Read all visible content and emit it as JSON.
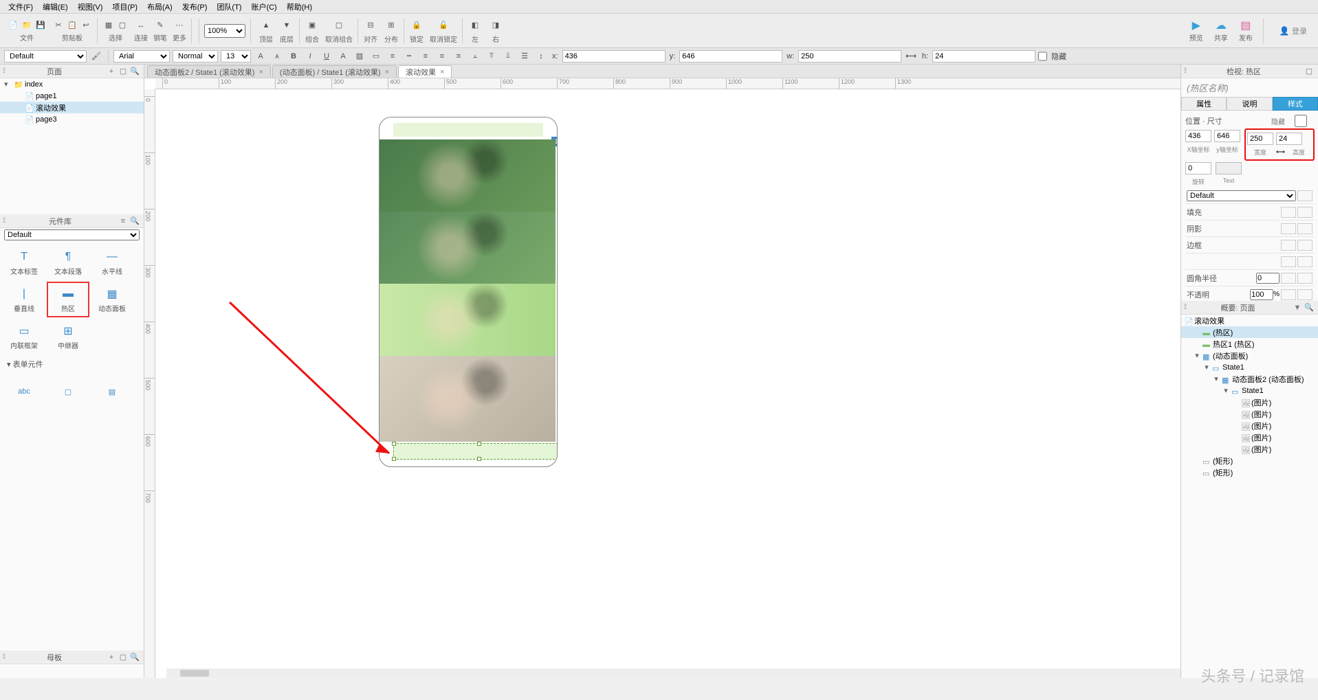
{
  "menu": [
    "文件(F)",
    "编辑(E)",
    "视图(V)",
    "项目(P)",
    "布局(A)",
    "发布(P)",
    "团队(T)",
    "账户(C)",
    "帮助(H)"
  ],
  "toolbar_groups": [
    {
      "label": "文件",
      "icons": [
        "📄",
        "📁",
        "💾"
      ]
    },
    {
      "label": "剪贴板",
      "icons": [
        "✂",
        "📋",
        "↩"
      ]
    },
    {
      "label": "选择",
      "icons": [
        "▦",
        "▢"
      ]
    },
    {
      "label": "连接",
      "icons": [
        "↔"
      ]
    },
    {
      "label": "钢笔",
      "icons": [
        "✎"
      ]
    },
    {
      "label": "更多",
      "icons": [
        "⋯"
      ]
    }
  ],
  "zoom": "100%",
  "toolbar_groups2": [
    {
      "label": "顶层",
      "icon": "▲"
    },
    {
      "label": "底层",
      "icon": "▼"
    },
    {
      "label": "组合",
      "icon": "▣"
    },
    {
      "label": "取消组合",
      "icon": "▢"
    },
    {
      "label": "对齐",
      "icon": "⊟"
    },
    {
      "label": "分布",
      "icon": "⊞"
    },
    {
      "label": "锁定",
      "icon": "🔒"
    },
    {
      "label": "取消锁定",
      "icon": "🔓"
    },
    {
      "label": "左",
      "icon": "◧"
    },
    {
      "label": "右",
      "icon": "◨"
    }
  ],
  "right_buttons": [
    {
      "label": "预览",
      "icon": "▶",
      "color": "#36a0da"
    },
    {
      "label": "共享",
      "icon": "☁",
      "color": "#36a0da"
    },
    {
      "label": "发布",
      "icon": "▤",
      "color": "#d85a9a"
    }
  ],
  "login": "登录",
  "format": {
    "style_preset": "Default",
    "font": "Arial",
    "weight": "Normal",
    "size": "13",
    "x": "436",
    "y": "646",
    "w": "250",
    "h": "24",
    "hide": "隐藏"
  },
  "panels": {
    "sitemap": {
      "title": "页面",
      "items": [
        {
          "label": "index",
          "indent": 0,
          "expanded": true,
          "folder": true
        },
        {
          "label": "page1",
          "indent": 1
        },
        {
          "label": "滚动效果",
          "indent": 1,
          "selected": true
        },
        {
          "label": "page3",
          "indent": 1
        }
      ]
    },
    "library": {
      "title": "元件库",
      "preset": "Default",
      "items1": [
        {
          "label": "文本标签"
        },
        {
          "label": "文本段落"
        },
        {
          "label": "水平线"
        },
        {
          "label": "垂直线"
        },
        {
          "label": "热区",
          "hl": true
        },
        {
          "label": "动态面板"
        },
        {
          "label": "内联框架"
        },
        {
          "label": "中继器"
        }
      ],
      "section": "表单元件"
    },
    "master": {
      "title": "母板"
    }
  },
  "tabs": [
    {
      "label": "动态面板2 / State1 (滚动效果)"
    },
    {
      "label": "(动态面板) / State1 (滚动效果)"
    },
    {
      "label": "滚动效果",
      "active": true
    }
  ],
  "ruler_ticks": [
    0,
    100,
    200,
    300,
    400,
    500,
    600,
    700,
    800,
    900,
    1000,
    1100,
    1200,
    1300
  ],
  "ruler_vticks": [
    0,
    100,
    200,
    300,
    400,
    500,
    600,
    700
  ],
  "inspector": {
    "title": "检视: 热区",
    "name": "(热区名称)",
    "tabs": [
      "属性",
      "说明",
      "样式"
    ],
    "active": 2,
    "pos_label": "位置 · 尺寸",
    "hide": "隐藏",
    "x": "436",
    "y": "646",
    "w": "250",
    "h": "24",
    "xlbl": "X轴坐标",
    "ylbl": "y轴坐标",
    "wlbl": "宽度",
    "hlbl": "高度",
    "rot": "0",
    "rotlbl": "旋转",
    "txt": "",
    "txtlbl": "Text",
    "default": "Default",
    "props": [
      "填充",
      "阴影",
      "边框",
      "",
      "圆角半径",
      "不透明"
    ],
    "opacity": "100"
  },
  "outline": {
    "title": "概要: 页面",
    "root": "滚动效果",
    "items": [
      {
        "label": "(热区)",
        "indent": 1,
        "sel": true,
        "type": "hot"
      },
      {
        "label": "热区1 (热区)",
        "indent": 1,
        "type": "hot"
      },
      {
        "label": "(动态面板)",
        "indent": 1,
        "type": "dp",
        "exp": true
      },
      {
        "label": "State1",
        "indent": 2,
        "type": "state",
        "exp": true
      },
      {
        "label": "动态面板2 (动态面板)",
        "indent": 3,
        "type": "dp",
        "exp": true
      },
      {
        "label": "State1",
        "indent": 4,
        "type": "state",
        "exp": true
      },
      {
        "label": "(图片)",
        "indent": 5,
        "type": "img"
      },
      {
        "label": "(图片)",
        "indent": 5,
        "type": "img"
      },
      {
        "label": "(图片)",
        "indent": 5,
        "type": "img"
      },
      {
        "label": "(图片)",
        "indent": 5,
        "type": "img"
      },
      {
        "label": "(图片)",
        "indent": 5,
        "type": "img"
      },
      {
        "label": "(矩形)",
        "indent": 1,
        "type": "rect"
      },
      {
        "label": "(矩形)",
        "indent": 1,
        "type": "rect"
      }
    ]
  },
  "watermark": "头条号 / 记录馆"
}
